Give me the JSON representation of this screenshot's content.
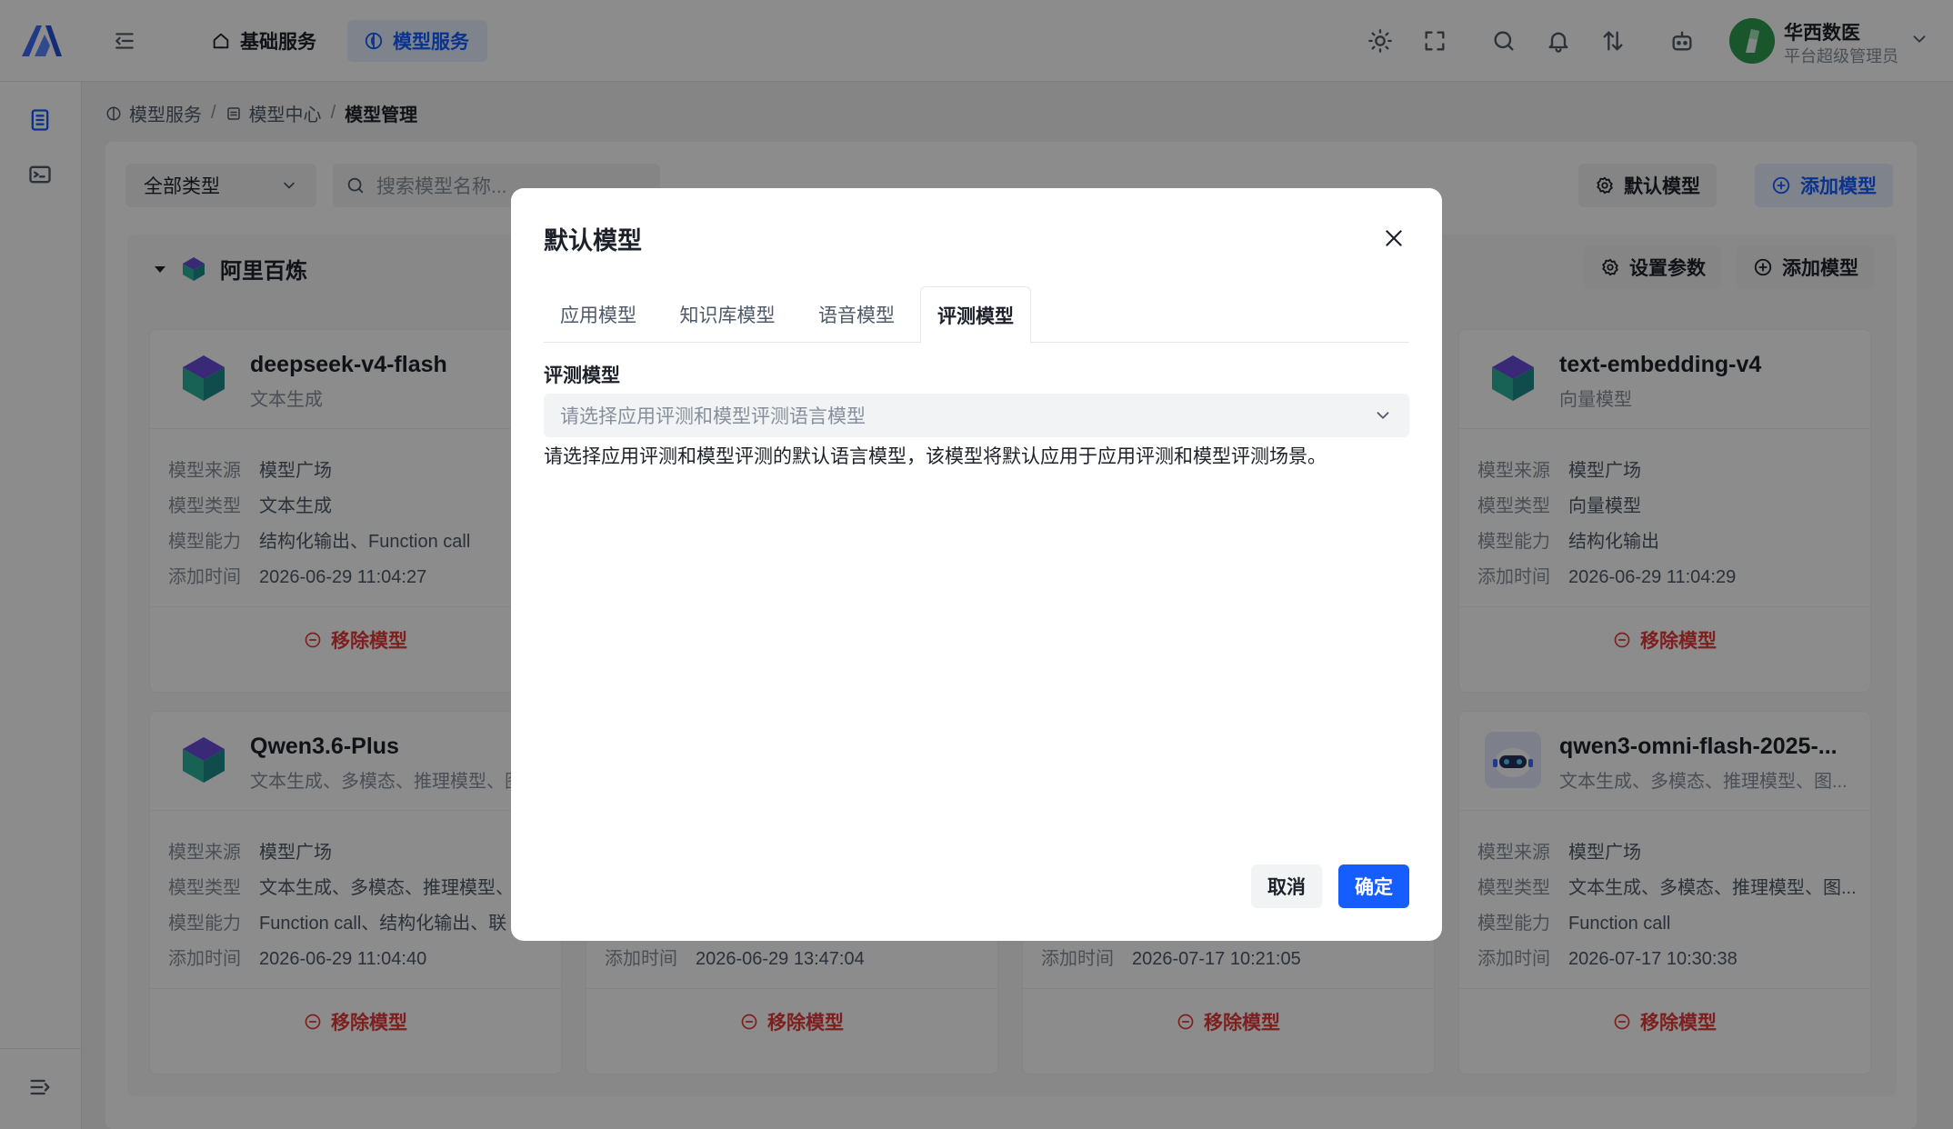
{
  "header": {
    "nav": [
      {
        "label": "基础服务",
        "icon": "home-icon"
      },
      {
        "label": "模型服务",
        "icon": "model-service-icon"
      }
    ],
    "user": {
      "name": "华西数医",
      "role": "平台超级管理员"
    }
  },
  "breadcrumb": [
    "模型服务",
    "模型中心",
    "模型管理"
  ],
  "toolbar": {
    "type_select": "全部类型",
    "search_placeholder": "搜索模型名称...",
    "default_model_label": "默认模型",
    "add_model_label": "添加模型"
  },
  "provider": {
    "name": "阿里百炼",
    "set_params_label": "设置参数",
    "add_model_label": "添加模型"
  },
  "field_labels": {
    "source": "模型来源",
    "type": "模型类型",
    "ability": "模型能力",
    "added": "添加时间"
  },
  "cards": [
    {
      "name": "deepseek-v4-flash",
      "subtitle": "文本生成",
      "source": "模型广场",
      "type": "文本生成",
      "ability": "结构化输出、Function call",
      "added": "2026-06-29 11:04:27",
      "remove_label": "移除模型"
    },
    {
      "name": "text-embedding-v4",
      "subtitle": "向量模型",
      "source": "模型广场",
      "type": "向量模型",
      "ability": "结构化输出",
      "added": "2026-06-29 11:04:29",
      "remove_label": "移除模型"
    },
    {
      "name": "Qwen3.6-Plus",
      "subtitle": "文本生成、多模态、推理模型、图",
      "source": "模型广场",
      "type": "文本生成、多模态、推理模型、",
      "ability": "Function call、结构化输出、联",
      "added": "2026-06-29 11:04:40",
      "remove_label": "移除模型"
    },
    {
      "added": "2026-06-29 13:47:04",
      "remove_label": "移除模型"
    },
    {
      "added": "2026-07-17 10:21:05",
      "remove_label": "移除模型"
    },
    {
      "name": "qwen3-omni-flash-2025-...",
      "subtitle": "文本生成、多模态、推理模型、图...",
      "source": "模型广场",
      "type": "文本生成、多模态、推理模型、图...",
      "ability": "Function call",
      "added": "2026-07-17 10:30:38",
      "remove_label": "移除模型"
    }
  ],
  "modal": {
    "title": "默认模型",
    "tabs": [
      "应用模型",
      "知识库模型",
      "语音模型",
      "评测模型"
    ],
    "active_tab": "评测模型",
    "field_label": "评测模型",
    "select_placeholder": "请选择应用评测和模型评测语言模型",
    "description": "请选择应用评测和模型评测的默认语言模型，该模型将默认应用于应用评测和模型评测场景。",
    "cancel_label": "取消",
    "ok_label": "确定"
  },
  "colors": {
    "accent": "#165dff",
    "danger": "#e53a3a",
    "overlay": "rgba(0,0,0,0.45)"
  }
}
